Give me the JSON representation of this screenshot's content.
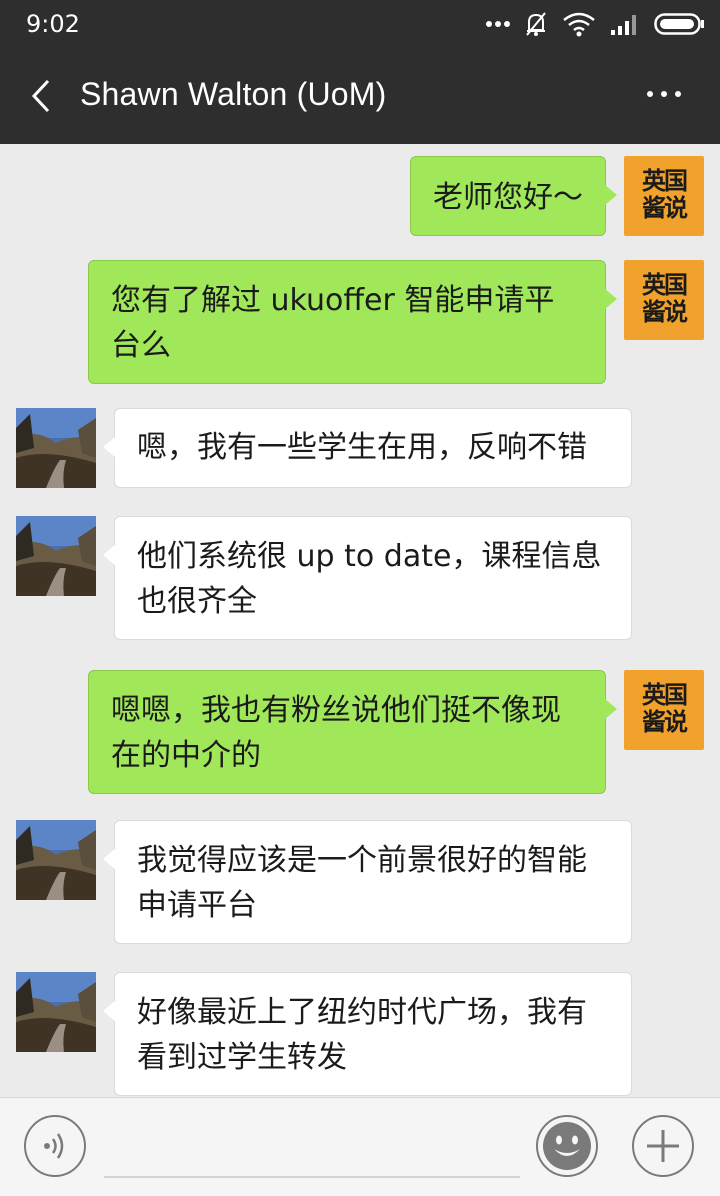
{
  "status_bar": {
    "time": "9:02"
  },
  "header": {
    "title": "Shawn Walton (UoM)"
  },
  "me_avatar_text": "英国\n酱说",
  "messages": [
    {
      "from": "me",
      "text": "老师您好～"
    },
    {
      "from": "me",
      "text": "您有了解过 ukuoffer 智能申请平台么"
    },
    {
      "from": "other",
      "text": "嗯，我有一些学生在用，反响不错"
    },
    {
      "from": "other",
      "text": "他们系统很 up to date，课程信息也很齐全"
    },
    {
      "from": "me",
      "text": "嗯嗯，我也有粉丝说他们挺不像现在的中介的"
    },
    {
      "from": "other",
      "text": "我觉得应该是一个前景很好的智能申请平台"
    },
    {
      "from": "other",
      "text": "好像最近上了纽约时代广场，我有看到过学生转发"
    }
  ],
  "colors": {
    "bar": "#2e2e2e",
    "bubble_me": "#a0e75a",
    "bubble_other": "#ffffff",
    "avatar_me": "#f0a22c",
    "background": "#ebebeb"
  },
  "icons": [
    "back-arrow-icon",
    "more-icon",
    "voice-icon",
    "emoji-icon",
    "plus-icon",
    "dots-icon",
    "mute-icon",
    "wifi-icon",
    "signal-icon",
    "battery-icon"
  ]
}
